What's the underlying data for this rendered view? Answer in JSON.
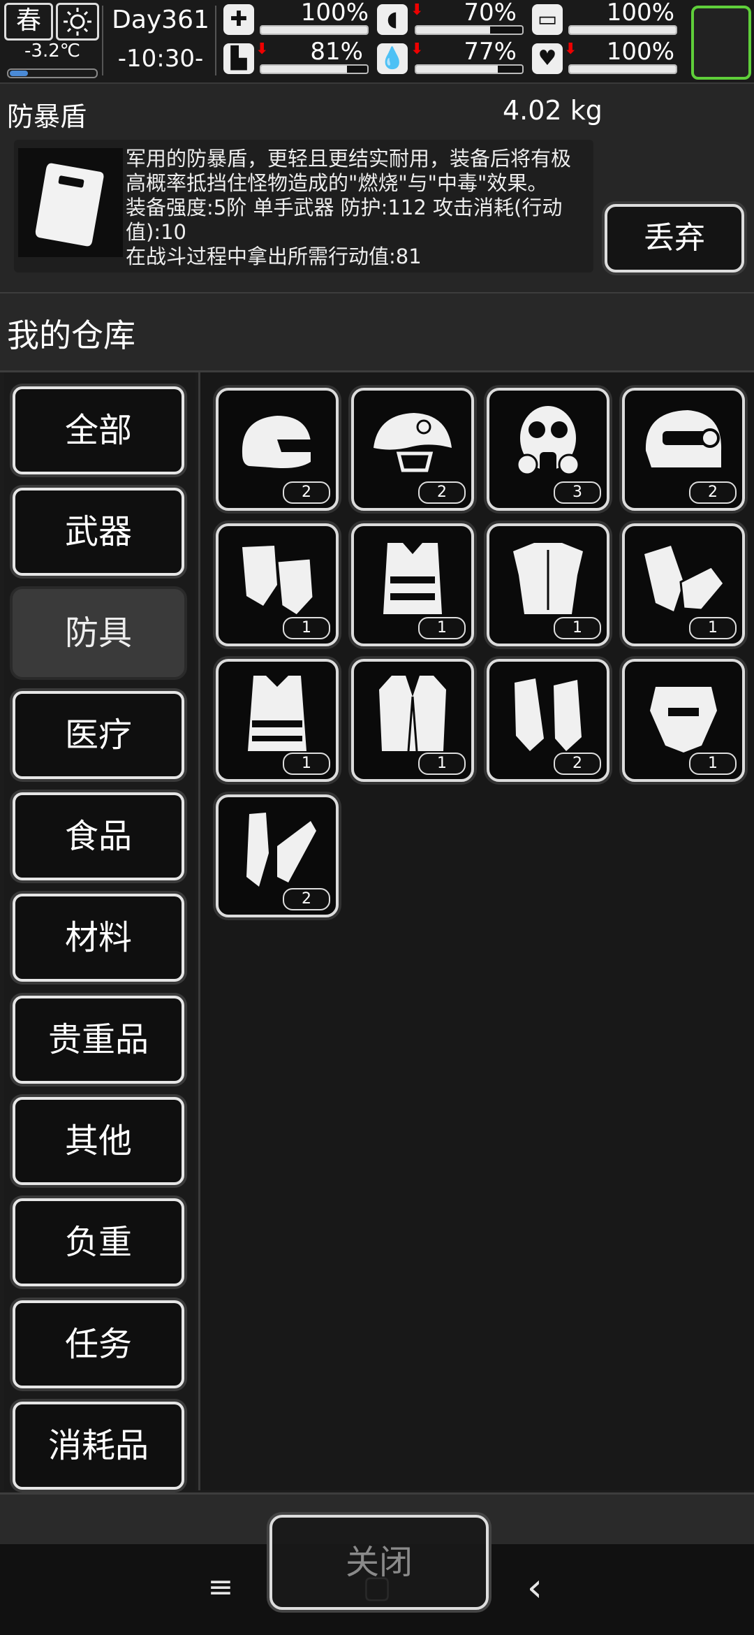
{
  "status": {
    "season": "春",
    "weather_icon": "sun-icon",
    "temperature": "-3.2℃",
    "temperature_level": 0.15,
    "day": "Day361",
    "time": "-10:30-",
    "stats": [
      {
        "icon": "first-aid-icon",
        "value": "100%",
        "level": 1.0,
        "decreasing": false
      },
      {
        "icon": "stomach-icon",
        "value": "70%",
        "level": 0.7,
        "decreasing": true
      },
      {
        "icon": "bandage-icon",
        "value": "100%",
        "level": 1.0,
        "decreasing": false
      },
      {
        "icon": "foot-icon",
        "value": "81%",
        "level": 0.81,
        "decreasing": true
      },
      {
        "icon": "water-drop-icon",
        "value": "77%",
        "level": 0.77,
        "decreasing": true
      },
      {
        "icon": "heart-icon",
        "value": "100%",
        "level": 1.0,
        "decreasing": true
      }
    ],
    "accent_color": "#5fcf3a"
  },
  "item": {
    "name": "防暴盾",
    "weight": "4.02 kg",
    "description_lines": [
      "军用的防暴盾，更轻且更结实耐用，装备后将有极",
      "高概率抵挡住怪物造成的\"燃烧\"与\"中毒\"效果。",
      "装备强度:5阶 单手武器  防护:112 攻击消耗(行动",
      "值):10",
      "在战斗过程中拿出所需行动值:81"
    ],
    "discard_label": "丢弃"
  },
  "warehouse": {
    "title": "我的仓库",
    "categories": [
      "全部",
      "武器",
      "防具",
      "医疗",
      "食品",
      "材料",
      "贵重品",
      "其他",
      "负重",
      "任务",
      "消耗品"
    ],
    "active_category": "防具",
    "items": [
      {
        "icon": "motorcycle-helmet-icon",
        "qty": "2"
      },
      {
        "icon": "military-helmet-icon",
        "qty": "2"
      },
      {
        "icon": "gas-mask-icon",
        "qty": "3"
      },
      {
        "icon": "tactical-helmet-icon",
        "qty": "2"
      },
      {
        "icon": "fingerless-gloves-icon",
        "qty": "1"
      },
      {
        "icon": "tactical-vest-icon",
        "qty": "1"
      },
      {
        "icon": "body-armor-icon",
        "qty": "1"
      },
      {
        "icon": "gloves-icon",
        "qty": "1"
      },
      {
        "icon": "bulletproof-vest-icon",
        "qty": "1"
      },
      {
        "icon": "suit-jacket-icon",
        "qty": "1"
      },
      {
        "icon": "shin-guards-icon",
        "qty": "2"
      },
      {
        "icon": "power-armor-icon",
        "qty": "1"
      },
      {
        "icon": "arm-guards-icon",
        "qty": "2"
      }
    ]
  },
  "footer": {
    "close_label": "关闭"
  },
  "navbar": {
    "menu_icon": "≡",
    "home_icon": "▢",
    "back_icon": "‹"
  }
}
